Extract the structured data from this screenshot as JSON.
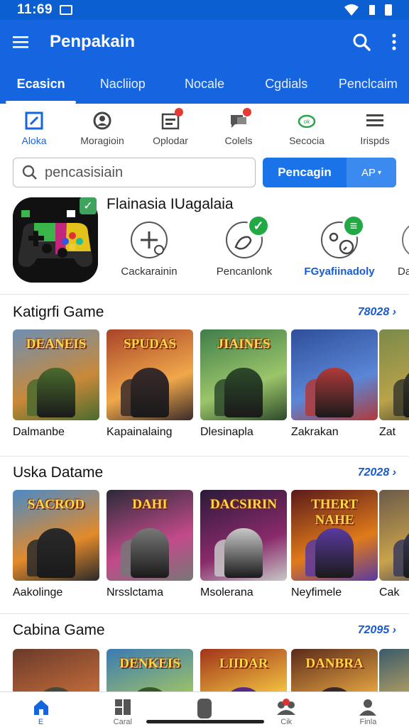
{
  "status": {
    "time": "11:69"
  },
  "appbar": {
    "title": "Penpakain"
  },
  "tabs": [
    {
      "label": "Ecasicn",
      "active": true
    },
    {
      "label": "Nacliiop"
    },
    {
      "label": "Nocale"
    },
    {
      "label": "Cgdials"
    },
    {
      "label": "Penclcaim"
    }
  ],
  "categories": [
    {
      "label": "Aloka",
      "icon": "edit-icon",
      "active": true
    },
    {
      "label": "Moragioin",
      "icon": "person-icon"
    },
    {
      "label": "Oplodar",
      "icon": "calendar-icon",
      "badge": true
    },
    {
      "label": "Colels",
      "icon": "chat-icon",
      "badge": true
    },
    {
      "label": "Secocia",
      "icon": "cloud-icon"
    },
    {
      "label": "Irispds",
      "icon": "menu-icon"
    }
  ],
  "search": {
    "placeholder": "pencasisiain",
    "button": "Pencagin",
    "alt": "AP"
  },
  "featured": {
    "title": "Flainasia IUagalaia",
    "items": [
      {
        "label": "Cackarainin",
        "icon": "add-icon"
      },
      {
        "label": "Pencanlonk",
        "icon": "hand-icon"
      },
      {
        "label": "FGyafiinadoly",
        "icon": "clock-icon"
      },
      {
        "label": "Da",
        "icon": "circle-icon"
      }
    ]
  },
  "sections": [
    {
      "title": "Katigrfi Game",
      "more": "78028",
      "cards": [
        {
          "name": "Dalmanbe",
          "banner": "DEANEIS"
        },
        {
          "name": "Kapainalaing",
          "banner": "SPUDAS"
        },
        {
          "name": "Dlesinapla",
          "banner": "JIAINES"
        },
        {
          "name": "Zakrakan",
          "banner": ""
        },
        {
          "name": "Zat",
          "banner": ""
        }
      ]
    },
    {
      "title": "Uska Datame",
      "more": "72028",
      "cards": [
        {
          "name": "Aakolinge",
          "banner": "SACROD"
        },
        {
          "name": "Nrsslctama",
          "banner": "DAHI"
        },
        {
          "name": "Msolerana",
          "banner": "DACSIRIN"
        },
        {
          "name": "Neyfimele",
          "banner": "THERT NAHE"
        },
        {
          "name": "Cak",
          "banner": ""
        }
      ]
    },
    {
      "title": "Cabina Game",
      "more": "72095",
      "cards": [
        {
          "name": "",
          "banner": ""
        },
        {
          "name": "",
          "banner": "DENKEIS"
        },
        {
          "name": "",
          "banner": "LIIDAR"
        },
        {
          "name": "",
          "banner": "DANBRA"
        },
        {
          "name": "",
          "banner": ""
        }
      ]
    }
  ],
  "bottomnav": [
    {
      "label": "E",
      "icon": "home-icon",
      "active": true
    },
    {
      "label": "Caral",
      "icon": "grid-icon"
    },
    {
      "label": "",
      "icon": "game-icon"
    },
    {
      "label": "Cik",
      "icon": "community-icon"
    },
    {
      "label": "Finla",
      "icon": "profile-icon"
    }
  ],
  "colors": {
    "primary": "#1565e0",
    "accent": "#1a73e8",
    "green": "#22a845"
  }
}
